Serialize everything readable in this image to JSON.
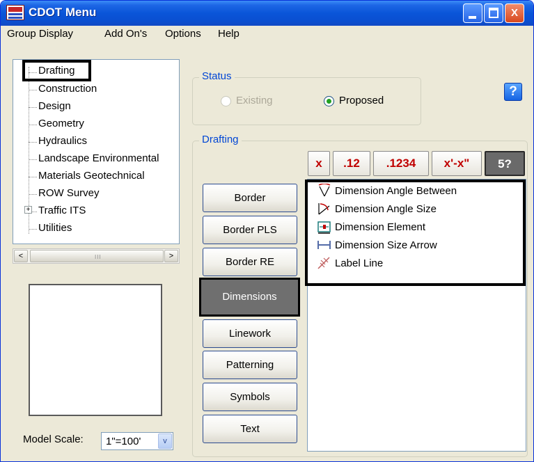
{
  "window": {
    "title": "CDOT Menu",
    "minimize_label": "",
    "maximize_label": "",
    "close_label": "X"
  },
  "menu": [
    "Group Display",
    "Add On's",
    "Options",
    "Help"
  ],
  "tree": {
    "items": [
      {
        "label": "Drafting"
      },
      {
        "label": "Construction"
      },
      {
        "label": "Design"
      },
      {
        "label": "Geometry"
      },
      {
        "label": "Hydraulics"
      },
      {
        "label": "Landscape Environmental"
      },
      {
        "label": "Materials Geotechnical"
      },
      {
        "label": "ROW Survey"
      },
      {
        "label": "Traffic ITS"
      },
      {
        "label": "Utilities"
      }
    ],
    "expander": "+",
    "selected": "Drafting"
  },
  "scrollbar": {
    "left": "<",
    "right": ">",
    "grip": "III"
  },
  "model_scale": {
    "label": "Model Scale:",
    "value": "1\"=100'",
    "arrow": "v"
  },
  "status": {
    "legend": "Status",
    "existing": "Existing",
    "proposed": "Proposed",
    "selected": "Proposed",
    "existing_enabled": false
  },
  "help_button": "?",
  "drafting": {
    "legend": "Drafting",
    "format_buttons": [
      "x",
      ".12",
      ".1234",
      "x'-x\"",
      "5?"
    ],
    "active_format": "5?",
    "categories": [
      "Border",
      "Border PLS",
      "Border RE",
      "Dimensions",
      "Linework",
      "Patterning",
      "Symbols",
      "Text"
    ],
    "selected_category": "Dimensions",
    "tools": [
      {
        "label": "Dimension Angle Between",
        "icon": "dimension-angle-between-icon"
      },
      {
        "label": "Dimension Angle Size",
        "icon": "dimension-angle-size-icon"
      },
      {
        "label": "Dimension Element",
        "icon": "dimension-element-icon"
      },
      {
        "label": "Dimension Size Arrow",
        "icon": "dimension-size-arrow-icon"
      },
      {
        "label": "Label Line",
        "icon": "label-line-icon"
      }
    ]
  },
  "colors": {
    "titlebar": "#0a55d8",
    "window_bg": "#ece9d8",
    "legend_text": "#0046d5",
    "format_text": "#c00000",
    "radio_dot": "#21a121"
  }
}
